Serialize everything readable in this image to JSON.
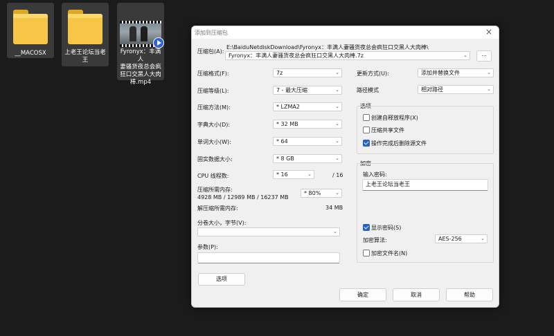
{
  "desktop": {
    "icons": [
      {
        "label": "__MACOSX"
      },
      {
        "label": "上老王论坛当老\n王"
      },
      {
        "label": "Fyronyx：丰满人\n妻骚货夜总会疯\n狂口交黑人大肉\n棒.mp4"
      }
    ]
  },
  "dialog": {
    "title": "添加到压缩包",
    "archive": {
      "label": "压缩包(A):",
      "path": "E:\\BaiduNetdiskDownload\\Fyronyx：丰满人妻骚货夜总会疯狂口交黑人大肉棒\\",
      "filename": "Fyronyx：丰满人妻骚货夜总会疯狂口交黑人大肉棒.7z",
      "browse_label": "..."
    },
    "format": {
      "label": "压缩格式(F):",
      "value": "7z"
    },
    "level": {
      "label": "压缩等级(L):",
      "value": "7 - 最大压缩"
    },
    "method": {
      "label": "压缩方法(M):",
      "value": "* LZMA2"
    },
    "dict": {
      "label": "字典大小(D):",
      "value": "* 32 MB"
    },
    "word": {
      "label": "单词大小(W):",
      "value": "* 64"
    },
    "solid": {
      "label": "固实数据大小:",
      "value": "* 8 GB"
    },
    "cpu": {
      "label": "CPU 线程数:",
      "value": "* 16",
      "max": "/ 16"
    },
    "memory": {
      "label": "压缩所需内存:",
      "detail": "4928 MB / 12989 MB / 16237 MB",
      "value": "* 80%"
    },
    "decompress_memory": {
      "label": "解压缩所需内存:",
      "value": "34 MB"
    },
    "split": {
      "label": "分卷大小，字节(V):",
      "value": ""
    },
    "params": {
      "label": "参数(P):",
      "value": ""
    },
    "options_button": "选项",
    "update_mode": {
      "label": "更新方式(U):",
      "value": "添加并替换文件"
    },
    "path_mode": {
      "label": "路径模式",
      "value": "相对路径"
    },
    "options_group": {
      "title": "选项",
      "sfx": {
        "label": "创建自释放程序(X)",
        "checked": false
      },
      "shared": {
        "label": "压缩共享文件",
        "checked": false
      },
      "delete_after": {
        "label": "操作完成后删除源文件",
        "checked": true
      }
    },
    "encryption_group": {
      "title": "加密",
      "password_label": "输入密码:",
      "password_value": "上老王论坛当老王",
      "show_password": {
        "label": "显示密码(S)",
        "checked": true
      },
      "method_label": "加密算法:",
      "method_value": "AES-256",
      "encrypt_names": {
        "label": "加密文件名(N)",
        "checked": false
      }
    },
    "buttons": {
      "ok": "确定",
      "cancel": "取消",
      "help": "帮助"
    }
  }
}
